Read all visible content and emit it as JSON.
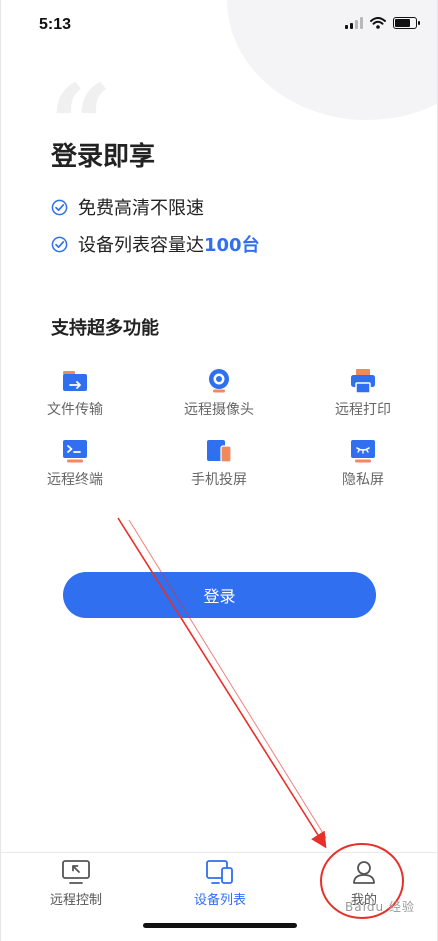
{
  "status_bar": {
    "time": "5:13",
    "battery_level": 0.75
  },
  "hero": {
    "quote_mark": "“",
    "title": "登录即享",
    "benefits": [
      {
        "text": "免费高清不限速",
        "highlight": ""
      },
      {
        "text": "设备列表容量达",
        "highlight": "100台"
      }
    ]
  },
  "features": {
    "title": "支持超多功能",
    "items": [
      {
        "label": "文件传输",
        "icon": "file-transfer-icon"
      },
      {
        "label": "远程摄像头",
        "icon": "webcam-icon"
      },
      {
        "label": "远程打印",
        "icon": "printer-icon"
      },
      {
        "label": "远程终端",
        "icon": "terminal-icon"
      },
      {
        "label": "手机投屏",
        "icon": "phone-mirror-icon"
      },
      {
        "label": "隐私屏",
        "icon": "privacy-screen-icon"
      }
    ]
  },
  "login_button": {
    "label": "登录"
  },
  "tab_bar": {
    "tabs": [
      {
        "label": "远程控制",
        "icon": "remote-control-icon",
        "active": false
      },
      {
        "label": "设备列表",
        "icon": "device-list-icon",
        "active": true
      },
      {
        "label": "我的",
        "icon": "profile-icon",
        "active": false
      }
    ]
  },
  "colors": {
    "accent": "#2f6ff0",
    "orange": "#f08a5d",
    "annotation_red": "#e8302a"
  },
  "watermark": "Baidu 经验"
}
